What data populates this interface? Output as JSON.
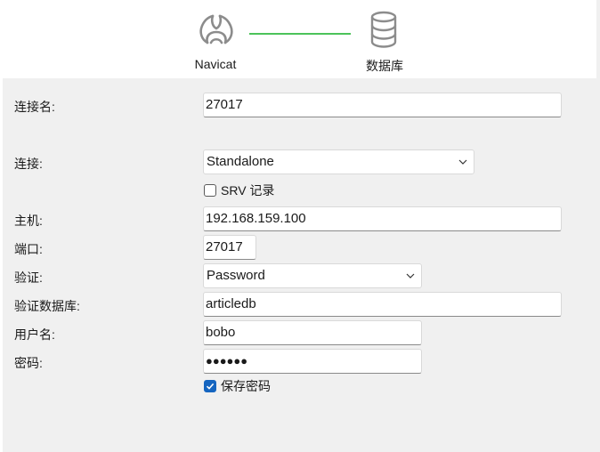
{
  "header": {
    "steps": [
      {
        "label": "Navicat",
        "icon": "navicat-logo-icon"
      },
      {
        "label": "数据库",
        "icon": "database-icon"
      }
    ],
    "connector_color": "#4cc35a"
  },
  "form": {
    "connection_name": {
      "label": "连接名:",
      "value": "27017"
    },
    "connection": {
      "label": "连接:",
      "selected": "Standalone"
    },
    "srv_record": {
      "label": "SRV 记录",
      "checked": false
    },
    "host": {
      "label": "主机:",
      "value": "192.168.159.100"
    },
    "port": {
      "label": "端口:",
      "value": "27017"
    },
    "auth": {
      "label": "验证:",
      "selected": "Password"
    },
    "auth_db": {
      "label": "验证数据库:",
      "value": "articledb"
    },
    "username": {
      "label": "用户名:",
      "value": "bobo"
    },
    "password": {
      "label": "密码:",
      "value": "●●●●●●"
    },
    "save_password": {
      "label": "保存密码",
      "checked": true
    }
  },
  "colors": {
    "accent": "#1565c0",
    "background": "#f0f0f0"
  }
}
